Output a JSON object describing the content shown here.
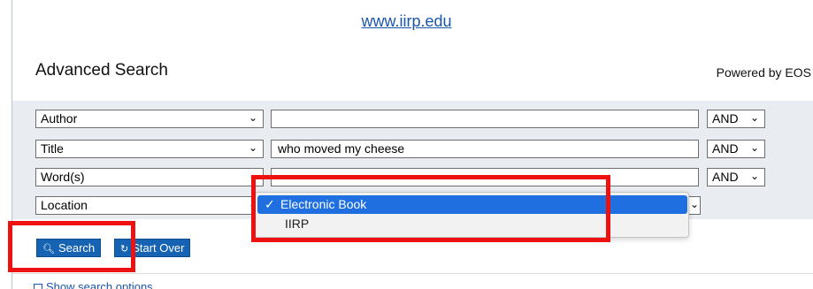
{
  "header": {
    "site_url": "www.iirp.edu"
  },
  "page": {
    "title": "Advanced Search",
    "powered_by": "Powered by EOS"
  },
  "search_rows": [
    {
      "field": "Author",
      "value": "",
      "operator": "AND"
    },
    {
      "field": "Title",
      "value": "who moved my cheese",
      "operator": "AND"
    },
    {
      "field": "Word(s)",
      "value": "",
      "operator": "AND"
    },
    {
      "field": "Location"
    }
  ],
  "location_dropdown": {
    "options": [
      "Electronic Book",
      "IIRP"
    ],
    "selected": "Electronic Book",
    "check_glyph": "✓"
  },
  "buttons": {
    "search": "Search",
    "start_over": "Start Over"
  },
  "footer": {
    "show_options": "Show search options"
  },
  "colors": {
    "accent": "#1663b3",
    "highlight_box": "#ee1111",
    "dropdown_selected": "#1f6fe0",
    "panel_bg": "#e9ecf0"
  },
  "icons": {
    "search": "magnifier-icon",
    "start_over": "refresh-icon",
    "select_arrow": "chevron-down-icon"
  }
}
